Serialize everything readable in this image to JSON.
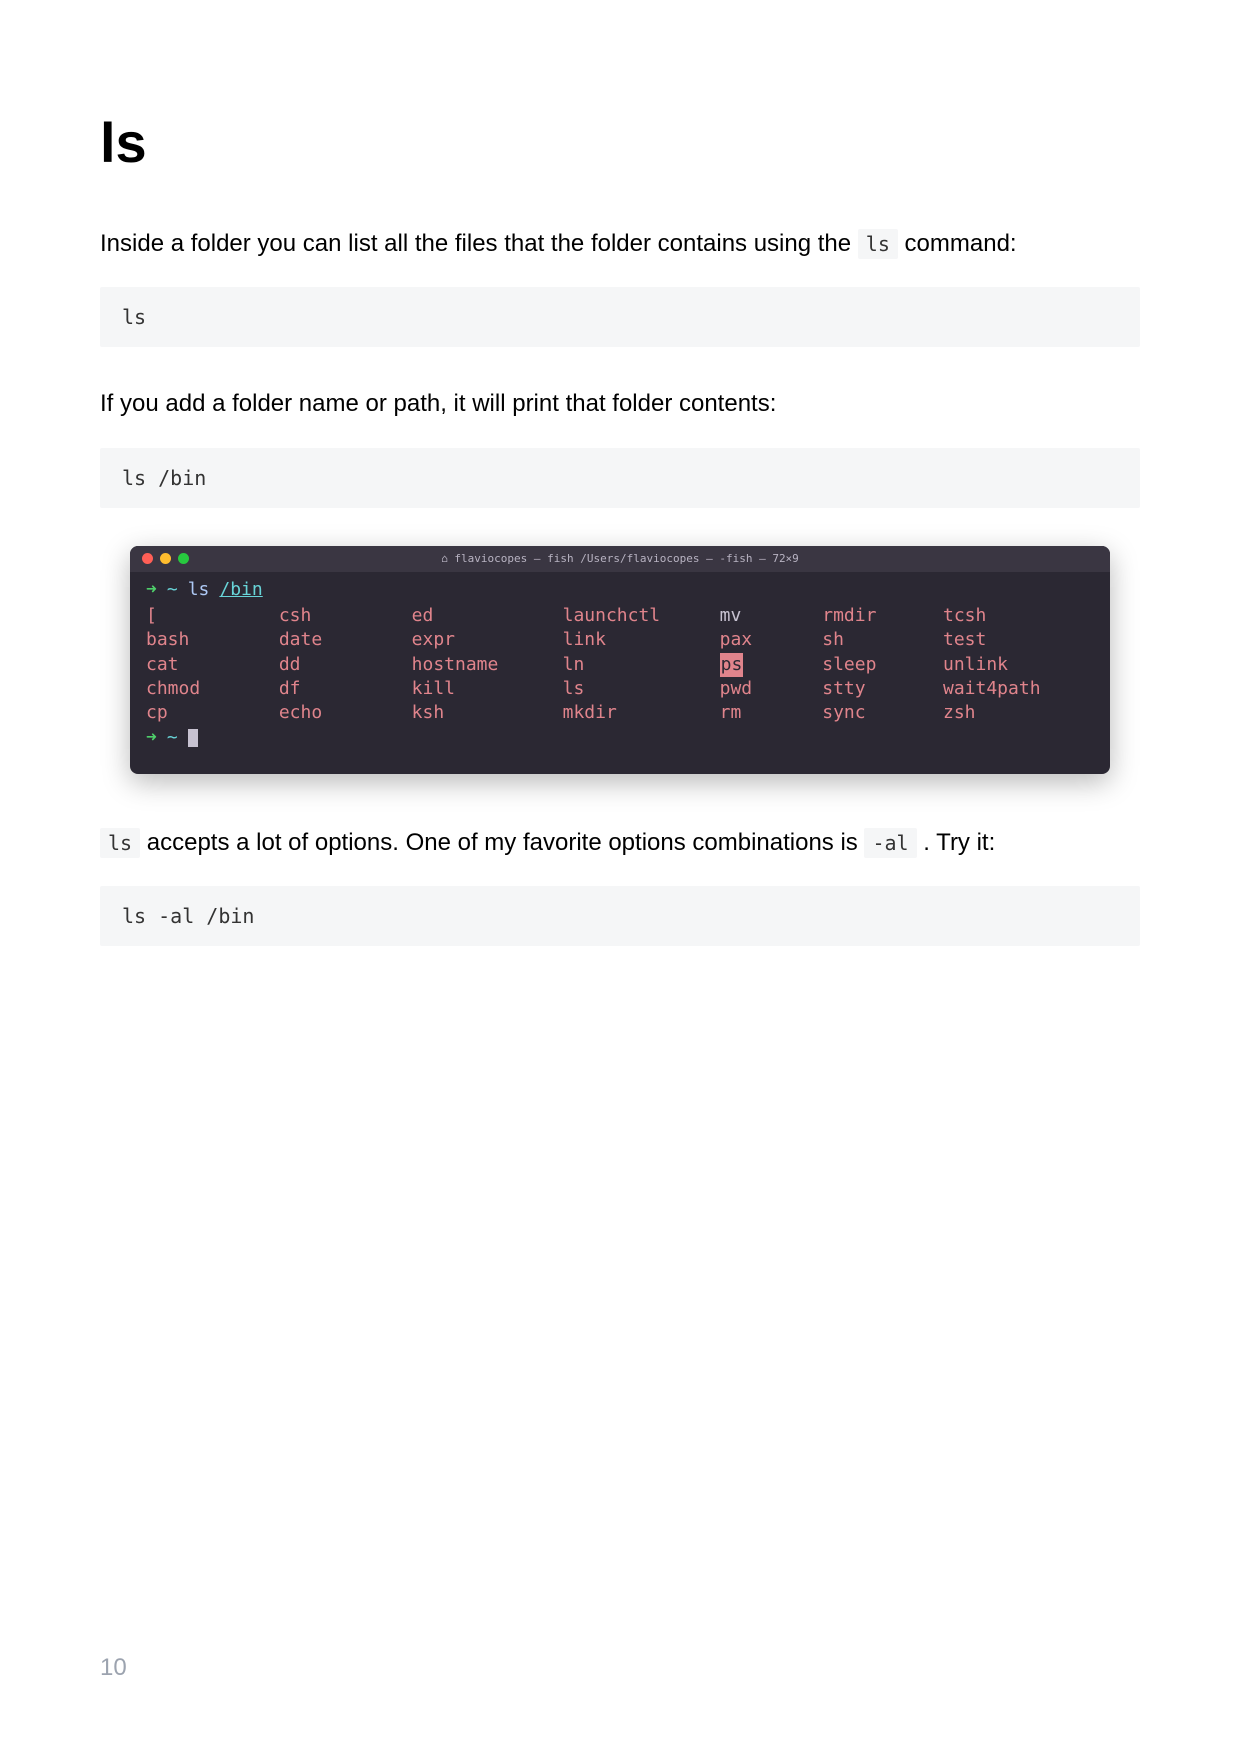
{
  "heading": "ls",
  "para1_a": "Inside a folder you can list all the files that the folder contains using the ",
  "para1_code": "ls",
  "para1_b": " command:",
  "code1": "ls",
  "para2": "If you add a folder name or path, it will print that folder contents:",
  "code2": "ls /bin",
  "terminal": {
    "title": "⌂ flaviocopes — fish   /Users/flaviocopes — -fish — 72×9",
    "prompt_cmd": "ls",
    "prompt_arg": "/bin",
    "cols": [
      [
        "[",
        "bash",
        "cat",
        "chmod",
        "cp"
      ],
      [
        "csh",
        "date",
        "dd",
        "df",
        "echo"
      ],
      [
        "ed",
        "expr",
        "hostname",
        "kill",
        "ksh"
      ],
      [
        "launchctl",
        "link",
        "ln",
        "ls",
        "mkdir"
      ],
      [
        "mv",
        "pax",
        "ps",
        "pwd",
        "rm"
      ],
      [
        "rmdir",
        "sh",
        "sleep",
        "stty",
        "sync"
      ],
      [
        "tcsh",
        "test",
        "unlink",
        "wait4path",
        "zsh"
      ]
    ]
  },
  "para3_code1": "ls",
  "para3_a": " accepts a lot of options. One of my favorite options combinations is ",
  "para3_code2": "-al",
  "para3_b": " . Try it:",
  "code3": "ls -al /bin",
  "page_number": "10"
}
